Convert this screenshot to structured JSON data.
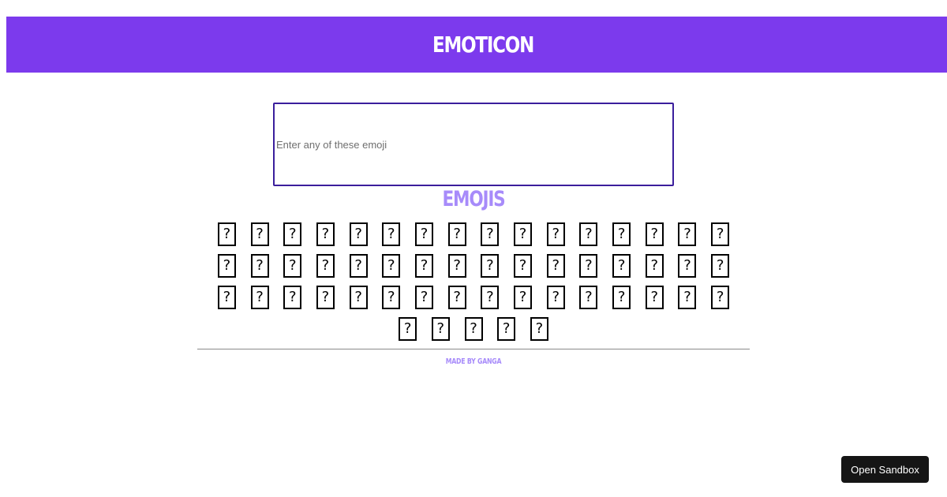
{
  "header": {
    "title": "EMOTICON"
  },
  "search": {
    "placeholder": "Enter any of these emoji",
    "value": ""
  },
  "emojis": {
    "title": "EMOJIS",
    "items": [
      "?",
      "?",
      "?",
      "?",
      "?",
      "?",
      "?",
      "?",
      "?",
      "?",
      "?",
      "?",
      "?",
      "?",
      "?",
      "?",
      "?",
      "?",
      "?",
      "?",
      "?",
      "?",
      "?",
      "?",
      "?",
      "?",
      "?",
      "?",
      "?",
      "?",
      "?",
      "?",
      "?",
      "?",
      "?",
      "?",
      "?",
      "?",
      "?",
      "?",
      "?",
      "?",
      "?",
      "?",
      "?",
      "?",
      "?",
      "?",
      "?",
      "?",
      "?",
      "?",
      "?"
    ]
  },
  "footer": {
    "text": "MADE BY GANGA"
  },
  "sandbox": {
    "label": "Open Sandbox"
  },
  "colors": {
    "header_bg": "#7c3aed",
    "accent_light": "#a78bfa",
    "input_border": "#3b1e9c",
    "button_bg": "#151515"
  }
}
